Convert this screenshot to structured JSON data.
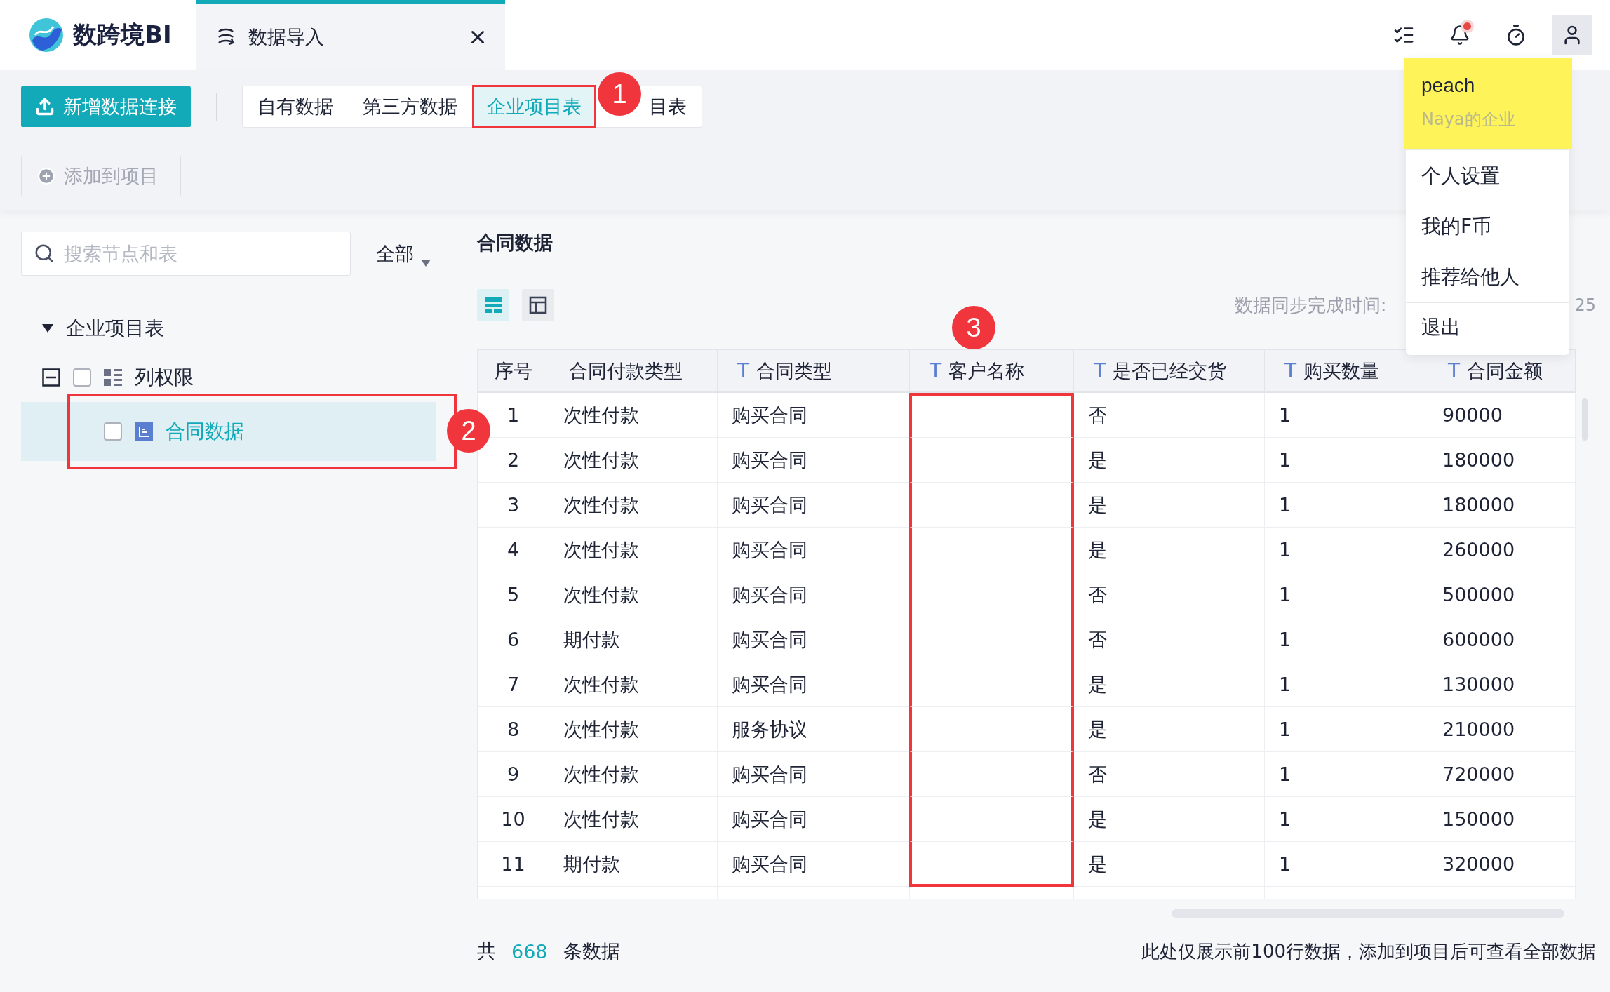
{
  "app": {
    "logo_text": "数跨境BI",
    "notifications_unread": true
  },
  "doc_tab": {
    "title": "数据导入",
    "selected": true
  },
  "primary_button": "新增数据连接",
  "source_tabs": [
    {
      "label": "自有数据",
      "selected": false,
      "highlighted": false
    },
    {
      "label": "第三方数据",
      "selected": false,
      "highlighted": false
    },
    {
      "label": "企业项目表",
      "selected": true,
      "highlighted": true,
      "badge": "1"
    },
    {
      "label": "目表",
      "selected": false,
      "highlighted": false
    }
  ],
  "add_button": {
    "label": "添加到项目",
    "disabled": true
  },
  "search": {
    "placeholder": "搜索节点和表"
  },
  "filter": "全部",
  "tree": [
    {
      "label": "企业项目表",
      "kind": "group",
      "expanded": true,
      "children": [
        {
          "label": "列权限",
          "kind": "folder",
          "checked": false,
          "expanded": true,
          "selected": false,
          "children": [
            {
              "label": "合同数据",
              "kind": "table",
              "checked": false,
              "selected": true,
              "highlighted": true,
              "badge": "2"
            }
          ]
        }
      ]
    }
  ],
  "detail": {
    "title": "合同数据",
    "view_modes": [
      {
        "kind": "rows",
        "selected": true
      },
      {
        "kind": "layout",
        "selected": false
      }
    ],
    "sync_label": "数据同步完成时间:",
    "sync_value": "25",
    "table": {
      "columns": [
        {
          "label": "序号",
          "highlighted": false
        },
        {
          "label": "合同付款类型",
          "highlighted": false
        },
        {
          "label": "合同类型",
          "type_mark": "T",
          "highlighted": false
        },
        {
          "label": "客户名称",
          "type_mark": "T",
          "highlighted": true,
          "badge": "3"
        },
        {
          "label": "是否已经交货",
          "type_mark": "T",
          "highlighted": false
        },
        {
          "label": "购买数量",
          "type_mark": "T",
          "highlighted": false
        },
        {
          "label": "合同金额",
          "type_mark": "T",
          "highlighted": false
        }
      ],
      "rows": [
        [
          "1",
          "次性付款",
          "购买合同",
          null,
          "否",
          "1",
          "90000"
        ],
        [
          "2",
          "次性付款",
          "购买合同",
          null,
          "是",
          "1",
          "180000"
        ],
        [
          "3",
          "次性付款",
          "购买合同",
          null,
          "是",
          "1",
          "180000"
        ],
        [
          "4",
          "次性付款",
          "购买合同",
          null,
          "是",
          "1",
          "260000"
        ],
        [
          "5",
          "次性付款",
          "购买合同",
          null,
          "否",
          "1",
          "500000"
        ],
        [
          "6",
          "期付款",
          "购买合同",
          null,
          "否",
          "1",
          "600000"
        ],
        [
          "7",
          "次性付款",
          "购买合同",
          null,
          "是",
          "1",
          "130000"
        ],
        [
          "8",
          "次性付款",
          "服务协议",
          null,
          "是",
          "1",
          "210000"
        ],
        [
          "9",
          "次性付款",
          "购买合同",
          null,
          "否",
          "1",
          "720000"
        ],
        [
          "10",
          "次性付款",
          "购买合同",
          null,
          "是",
          "1",
          "150000"
        ],
        [
          "11",
          "期付款",
          "购买合同",
          null,
          "是",
          "1",
          "320000"
        ]
      ]
    },
    "footer": {
      "prefix": "共",
      "count": "668",
      "suffix": "条数据",
      "note": "此处仅展示前100行数据，添加到项目后可查看全部数据"
    }
  },
  "user_menu": {
    "open": true,
    "user": "peach",
    "org": "Naya的企业",
    "highlighted": true,
    "items": [
      {
        "label": "个人设置",
        "divider_before": false
      },
      {
        "label": "我的F币",
        "divider_before": false
      },
      {
        "label": "推荐给他人",
        "divider_before": false
      },
      {
        "label": "退出",
        "divider_before": true
      }
    ]
  }
}
